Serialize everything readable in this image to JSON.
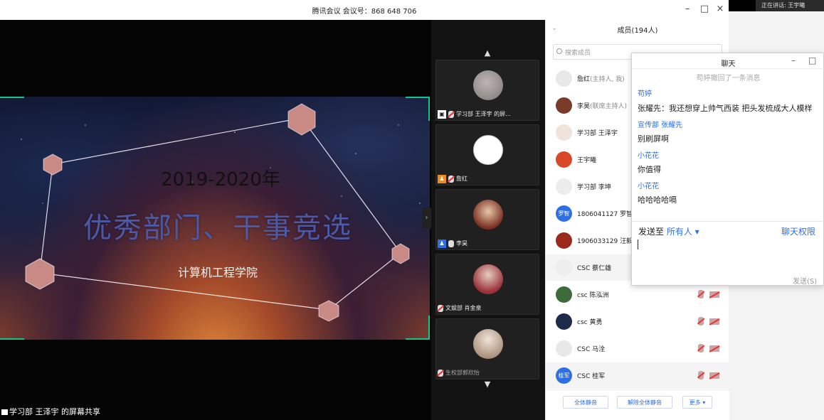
{
  "window": {
    "title": "腾讯会议 会议号：868 648 706",
    "speaking": "正在讲话: 王宇曦"
  },
  "stage": {
    "slide": {
      "year": "2019-2020年",
      "headline": "优秀部门、干事竞选",
      "college": "计算机工程学院"
    },
    "share_label": "学习部 王泽宇 的屏幕共享"
  },
  "thumbnails": [
    {
      "label": "学习部 王泽宇 的屏...",
      "badge": "screen",
      "mic": "off"
    },
    {
      "label": "詹红",
      "badge": "host",
      "mic": "off"
    },
    {
      "label": "李昊",
      "badge": "cohost",
      "mic": "on"
    },
    {
      "label": "文娱部 肖金泉",
      "badge": "",
      "mic": "off"
    },
    {
      "label": "生权部郭欣怡",
      "badge": "",
      "mic": "off"
    }
  ],
  "members_panel": {
    "header": "成员(194人)",
    "search_placeholder": "搜索成员",
    "members": [
      {
        "name": "詹红",
        "role": "(主持人, 我)",
        "avatar_text": "",
        "avatar_color": "#e8e8e8"
      },
      {
        "name": "李昊",
        "role": "(联席主持人)",
        "avatar_text": "",
        "avatar_color": "#7a3b2a"
      },
      {
        "name": "学习部 王泽宇",
        "role": "",
        "avatar_text": "",
        "avatar_color": "#efe3dc"
      },
      {
        "name": "王宇曦",
        "role": "",
        "avatar_text": "",
        "avatar_color": "#d9472b"
      },
      {
        "name": "学习部 李坤",
        "role": "",
        "avatar_text": "",
        "avatar_color": "#ececec"
      },
      {
        "name": "1806041127 罗智",
        "role": "",
        "avatar_text": "罗智",
        "avatar_color": "#2f6fe4"
      },
      {
        "name": "1906033129 汪毅",
        "role": "",
        "avatar_text": "",
        "avatar_color": "#9b2a1c"
      },
      {
        "name": "CSC 蔡仁雄",
        "role": "",
        "avatar_text": "",
        "avatar_color": "#eeeeee"
      },
      {
        "name": "csc 陈泓洲",
        "role": "",
        "avatar_text": "",
        "avatar_color": "#3d6b3b"
      },
      {
        "name": "csc 黄勇",
        "role": "",
        "avatar_text": "",
        "avatar_color": "#1d2a4a"
      },
      {
        "name": "CSC 马洤",
        "role": "",
        "avatar_text": "",
        "avatar_color": "#e8e8e8"
      },
      {
        "name": "CSC 桂军",
        "role": "",
        "avatar_text": "桂军",
        "avatar_color": "#2f6fe4"
      }
    ],
    "buttons": {
      "mute_all": "全体静音",
      "unmute_all": "解除全体静音",
      "more": "更多 ▾"
    }
  },
  "chat": {
    "title": "聊天",
    "notice": "苟婷撤回了一条消息",
    "messages": [
      {
        "sender": "苟婷",
        "text": "张耀先：我还想穿上帅气西装 把头发梳成大人模样"
      },
      {
        "sender": "宣传部 张耀先",
        "text": "别刷屏啊"
      },
      {
        "sender": "小花花",
        "text": "你值得"
      },
      {
        "sender": "小花花",
        "text": "哈哈哈哈嗝"
      }
    ],
    "send_to_label": "发送至",
    "send_to_target": "所有人",
    "permission": "聊天权限",
    "send_button": "发送(S)"
  }
}
